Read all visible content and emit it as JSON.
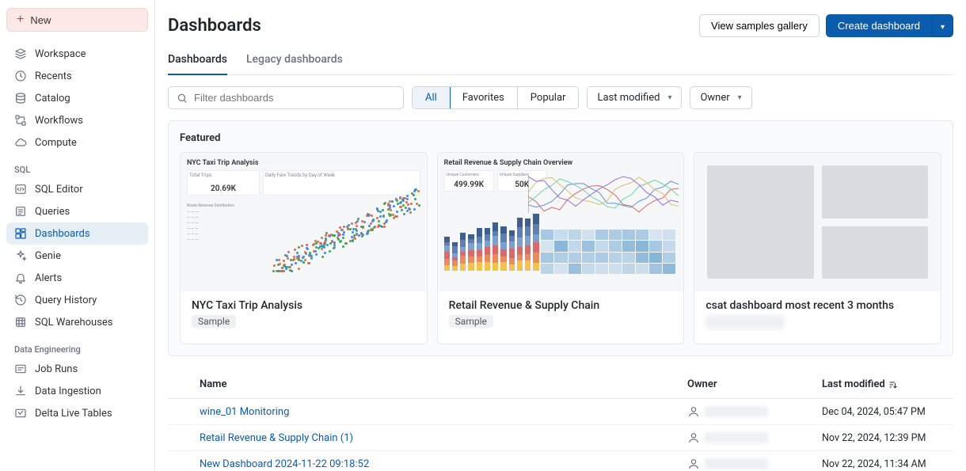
{
  "sidebar": {
    "new_label": "New",
    "main_items": [
      {
        "label": "Workspace",
        "icon": "workspace"
      },
      {
        "label": "Recents",
        "icon": "clock"
      },
      {
        "label": "Catalog",
        "icon": "catalog"
      },
      {
        "label": "Workflows",
        "icon": "workflows"
      },
      {
        "label": "Compute",
        "icon": "cloud"
      }
    ],
    "sql_label": "SQL",
    "sql_items": [
      {
        "label": "SQL Editor",
        "icon": "editor"
      },
      {
        "label": "Queries",
        "icon": "queries"
      },
      {
        "label": "Dashboards",
        "icon": "dashboards",
        "active": true
      },
      {
        "label": "Genie",
        "icon": "genie"
      },
      {
        "label": "Alerts",
        "icon": "alerts"
      },
      {
        "label": "Query History",
        "icon": "history"
      },
      {
        "label": "SQL Warehouses",
        "icon": "warehouses"
      }
    ],
    "de_label": "Data Engineering",
    "de_items": [
      {
        "label": "Job Runs",
        "icon": "jobruns"
      },
      {
        "label": "Data Ingestion",
        "icon": "ingestion"
      },
      {
        "label": "Delta Live Tables",
        "icon": "dlt"
      }
    ]
  },
  "header": {
    "title": "Dashboards",
    "samples_btn": "View samples gallery",
    "create_btn": "Create dashboard"
  },
  "tabs": [
    {
      "label": "Dashboards",
      "active": true
    },
    {
      "label": "Legacy dashboards",
      "active": false
    }
  ],
  "filters": {
    "search_placeholder": "Filter dashboards",
    "segments": [
      {
        "label": "All",
        "active": true
      },
      {
        "label": "Favorites",
        "active": false
      },
      {
        "label": "Popular",
        "active": false
      }
    ],
    "last_modified_label": "Last modified",
    "owner_label": "Owner"
  },
  "featured": {
    "title": "Featured",
    "cards": [
      {
        "title": "NYC Taxi Trip Analysis",
        "badge": "Sample",
        "preview": "nyc"
      },
      {
        "title": "Retail Revenue & Supply Chain",
        "badge": "Sample",
        "preview": "retail"
      },
      {
        "title": "csat dashboard most recent 3 months",
        "badge_blur": true,
        "preview": "skeleton"
      }
    ],
    "nyc_preview": {
      "header": "NYC Taxi Trip Analysis",
      "stat": "20.69K",
      "sub1": "Total Trips",
      "sub2": "Daily Fare Trends by Day of Week"
    },
    "retail_preview": {
      "header": "Retail Revenue & Supply Chain Overview",
      "stat1": "499.99K",
      "stat2": "50K",
      "lab1": "Unique Customers",
      "lab2": "Unique Suppliers"
    }
  },
  "table": {
    "headers": {
      "name": "Name",
      "owner": "Owner",
      "modified": "Last modified"
    },
    "rows": [
      {
        "name": "wine_01 Monitoring",
        "modified": "Dec 04, 2024, 05:47 PM"
      },
      {
        "name": "Retail Revenue & Supply Chain (1)",
        "modified": "Nov 22, 2024, 12:39 PM"
      },
      {
        "name": "New Dashboard 2024-11-22 09:18:52",
        "modified": "Nov 22, 2024, 11:34 AM"
      }
    ]
  }
}
